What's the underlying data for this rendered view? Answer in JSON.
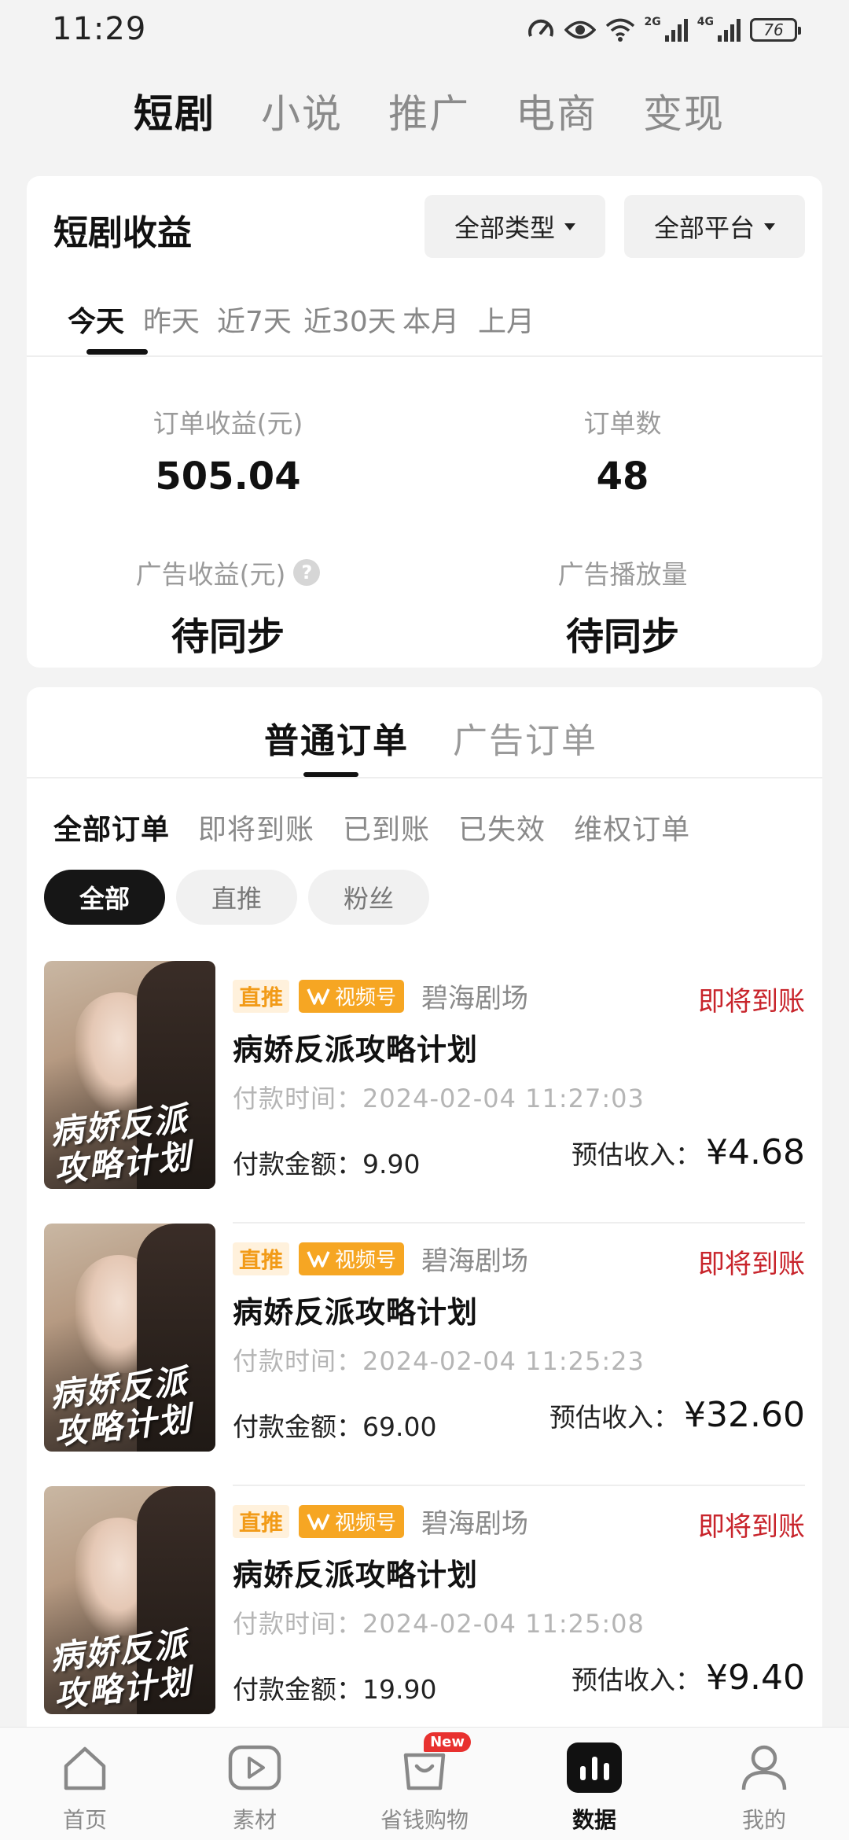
{
  "status_bar": {
    "time": "11:29",
    "net1": "2G",
    "net2": "4G",
    "battery": "76"
  },
  "top_tabs": [
    {
      "label": "短剧",
      "active": true
    },
    {
      "label": "小说"
    },
    {
      "label": "推广"
    },
    {
      "label": "电商"
    },
    {
      "label": "变现"
    }
  ],
  "earnings": {
    "title": "短剧收益",
    "filter_type": "全部类型",
    "filter_platform": "全部平台",
    "periods": [
      "今天",
      "昨天",
      "近7天",
      "近30天",
      "本月",
      "上月"
    ],
    "active_period": "今天",
    "metrics": {
      "order_income_label": "订单收益(元)",
      "order_income_value": "505.04",
      "order_count_label": "订单数",
      "order_count_value": "48",
      "ad_income_label": "广告收益(元)",
      "ad_income_value": "待同步",
      "ad_plays_label": "广告播放量",
      "ad_plays_value": "待同步",
      "help_glyph": "?"
    }
  },
  "orders": {
    "tabs": [
      "普通订单",
      "广告订单"
    ],
    "status_tabs": [
      "全部订单",
      "即将到账",
      "已到账",
      "已失效",
      "维权订单"
    ],
    "chips": [
      "全部",
      "直推",
      "粉丝"
    ],
    "items": [
      {
        "tag_direct": "直推",
        "tag_platform": "视频号",
        "theater": "碧海剧场",
        "status": "即将到账",
        "title": "病娇反派攻略计划",
        "pay_time": "付款时间：2024-02-04 11:27:03",
        "pay_amount": "付款金额：9.90",
        "income_label": "预估收入：",
        "income_value": "¥4.68",
        "poster_text": "病娇反派 攻略计划"
      },
      {
        "tag_direct": "直推",
        "tag_platform": "视频号",
        "theater": "碧海剧场",
        "status": "即将到账",
        "title": "病娇反派攻略计划",
        "pay_time": "付款时间：2024-02-04 11:25:23",
        "pay_amount": "付款金额：69.00",
        "income_label": "预估收入：",
        "income_value": "¥32.60",
        "poster_text": "病娇反派 攻略计划"
      },
      {
        "tag_direct": "直推",
        "tag_platform": "视频号",
        "theater": "碧海剧场",
        "status": "即将到账",
        "title": "病娇反派攻略计划",
        "pay_time": "付款时间：2024-02-04 11:25:08",
        "pay_amount": "付款金额：19.90",
        "income_label": "预估收入：",
        "income_value": "¥9.40",
        "poster_text": "病娇反派 攻略计划"
      }
    ]
  },
  "bottom_nav": [
    {
      "label": "首页",
      "icon": "home-icon"
    },
    {
      "label": "素材",
      "icon": "play-icon"
    },
    {
      "label": "省钱购物",
      "icon": "shopping-bag-icon",
      "badge": "New"
    },
    {
      "label": "数据",
      "icon": "data-chart-icon",
      "active": true
    },
    {
      "label": "我的",
      "icon": "profile-icon"
    }
  ],
  "colors": {
    "accent_red": "#c8242b",
    "tag_orange": "#f6a623",
    "active_black": "#111111"
  }
}
